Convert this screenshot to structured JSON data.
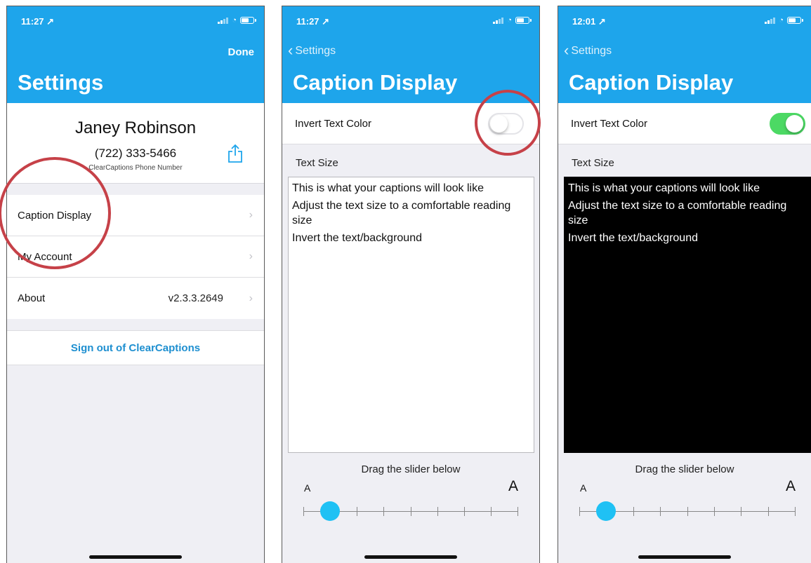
{
  "colors": {
    "header": "#1ea5eb",
    "link": "#1e8fd0",
    "toggle_on": "#4cd964",
    "slider_thumb": "#1fc1f4",
    "annotation": "#c64148"
  },
  "screen1": {
    "status": {
      "time": "11:27 ↗"
    },
    "header": {
      "done": "Done",
      "title": "Settings"
    },
    "profile": {
      "name": "Janey Robinson",
      "phone": "(722) 333-5466",
      "phone_caption": "ClearCaptions Phone Number",
      "share_icon": "share-icon"
    },
    "rows": [
      {
        "label": "Caption Display",
        "value": ""
      },
      {
        "label": "My Account",
        "value": ""
      },
      {
        "label": "About",
        "value": "v2.3.3.2649"
      }
    ],
    "signout": "Sign out of ClearCaptions"
  },
  "screen2": {
    "status": {
      "time": "11:27 ↗"
    },
    "header": {
      "back": "Settings",
      "title": "Caption Display"
    },
    "toggle": {
      "label": "Invert Text Color",
      "on": false
    },
    "text_size_label": "Text Size",
    "preview_lines": [
      "This is what your captions will look like",
      "Adjust the text size to a comfortable reading size",
      "Invert the text/background"
    ],
    "slider": {
      "hint": "Drag the slider below",
      "min_label": "A",
      "max_label": "A",
      "steps": 9,
      "value_index": 1
    }
  },
  "screen3": {
    "status": {
      "time": "12:01 ↗"
    },
    "header": {
      "back": "Settings",
      "title": "Caption Display"
    },
    "toggle": {
      "label": "Invert Text Color",
      "on": true
    },
    "text_size_label": "Text Size",
    "preview_lines": [
      "This is what your captions will look like",
      "Adjust the text size to a comfortable reading size",
      "Invert the text/background"
    ],
    "slider": {
      "hint": "Drag the slider below",
      "min_label": "A",
      "max_label": "A",
      "steps": 9,
      "value_index": 1
    }
  }
}
